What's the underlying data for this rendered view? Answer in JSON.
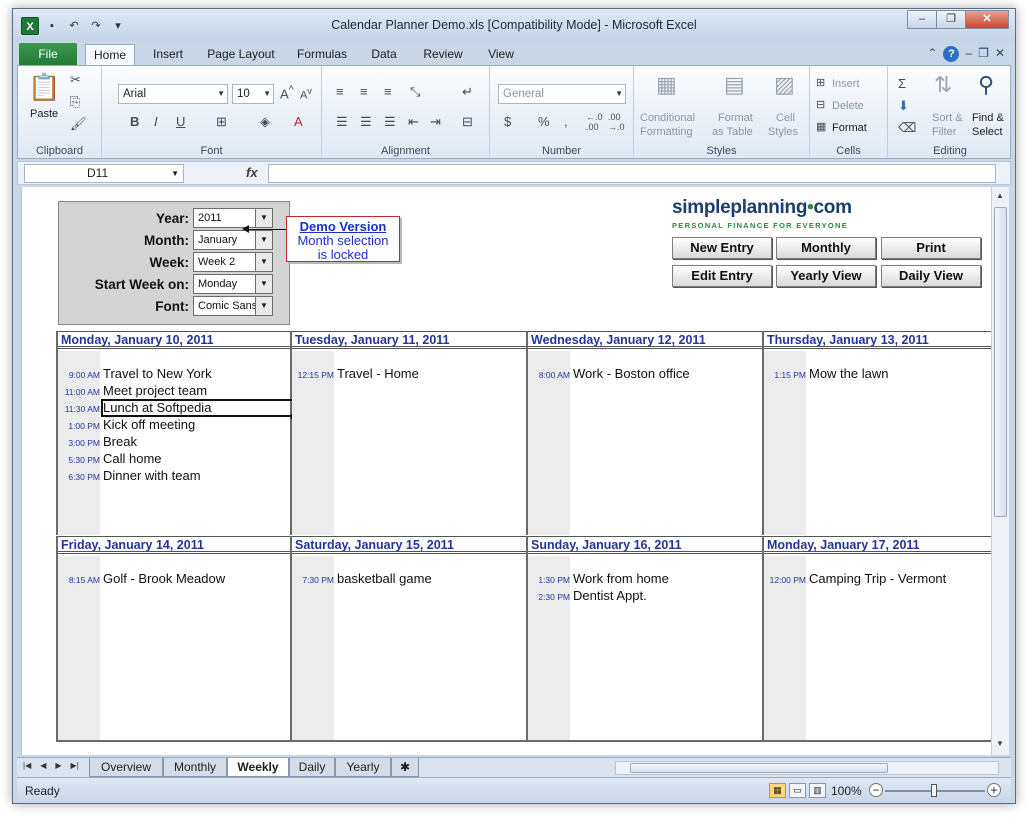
{
  "window": {
    "title": "Calendar Planner Demo.xls  [Compatibility Mode]  -  Microsoft Excel",
    "minimize": "–",
    "restore": "❐",
    "close": "✕"
  },
  "ribbon_tabs": [
    "File",
    "Home",
    "Insert",
    "Page Layout",
    "Formulas",
    "Data",
    "Review",
    "View"
  ],
  "ribbon": {
    "clipboard": {
      "label": "Clipboard",
      "paste": "Paste"
    },
    "font": {
      "label": "Font",
      "name": "Arial",
      "size": "10"
    },
    "alignment": {
      "label": "Alignment"
    },
    "number": {
      "label": "Number",
      "format": "General",
      "dollar": "$",
      "percent": "%",
      "comma": ","
    },
    "styles": {
      "label": "Styles",
      "conditional": "Conditional",
      "formatting": "Formatting",
      "format": "Format",
      "as_table": "as Table",
      "cell": "Cell",
      "cell_styles": "Styles"
    },
    "cells": {
      "label": "Cells",
      "insert": "Insert",
      "delete": "Delete",
      "format": "Format"
    },
    "editing": {
      "label": "Editing",
      "sort": "Sort &",
      "filter": "Filter",
      "find": "Find &",
      "select": "Select"
    }
  },
  "formula_bar": {
    "name_box": "D11",
    "fx": "fx",
    "value": ""
  },
  "controls": {
    "year": {
      "label": "Year:",
      "value": "2011"
    },
    "month": {
      "label": "Month:",
      "value": "January"
    },
    "week": {
      "label": "Week:",
      "value": "Week 2"
    },
    "start_week": {
      "label": "Start Week on:",
      "value": "Monday"
    },
    "font": {
      "label": "Font:",
      "value": "Comic Sans"
    }
  },
  "demo_note": {
    "title": "Demo Version",
    "line1": "Month selection",
    "line2": "is locked"
  },
  "logo": {
    "main": "simpleplanning",
    "dot": "•",
    "suffix": "com",
    "tagline": "PERSONAL FINANCE FOR EVERYONE"
  },
  "buttons": {
    "new_entry": "New Entry",
    "monthly": "Monthly",
    "print": "Print",
    "edit_entry": "Edit Entry",
    "yearly_view": "Yearly View",
    "daily_view": "Daily View"
  },
  "days": [
    {
      "header": "Monday, January 10, 2011",
      "entries": [
        {
          "time": "9:00 AM",
          "text": "Travel to New York"
        },
        {
          "time": "11:00 AM",
          "text": "Meet project team"
        },
        {
          "time": "11:30 AM",
          "text": "Lunch at Softpedia"
        },
        {
          "time": "1:00 PM",
          "text": "Kick off meeting"
        },
        {
          "time": "3:00 PM",
          "text": "Break"
        },
        {
          "time": "5:30 PM",
          "text": "Call home"
        },
        {
          "time": "6:30 PM",
          "text": "Dinner with team"
        }
      ]
    },
    {
      "header": "Tuesday, January 11, 2011",
      "entries": [
        {
          "time": "12:15 PM",
          "text": "Travel - Home"
        }
      ]
    },
    {
      "header": "Wednesday, January 12, 2011",
      "entries": [
        {
          "time": "8:00 AM",
          "text": "Work - Boston office"
        }
      ]
    },
    {
      "header": "Thursday, January 13, 2011",
      "entries": [
        {
          "time": "1:15 PM",
          "text": "Mow the lawn"
        }
      ]
    },
    {
      "header": "Friday, January 14, 2011",
      "entries": [
        {
          "time": "8:15 AM",
          "text": "Golf - Brook Meadow"
        }
      ]
    },
    {
      "header": "Saturday, January 15, 2011",
      "entries": [
        {
          "time": "7:30 PM",
          "text": "basketball game"
        }
      ]
    },
    {
      "header": "Sunday, January 16, 2011",
      "entries": [
        {
          "time": "1:30 PM",
          "text": "Work from home"
        },
        {
          "time": "2:30 PM",
          "text": "Dentist Appt."
        }
      ]
    },
    {
      "header": "Monday, January 17, 2011",
      "entries": [
        {
          "time": "12:00 PM",
          "text": "Camping Trip - Vermont"
        }
      ]
    }
  ],
  "sheet_tabs": [
    "Overview",
    "Monthly",
    "Weekly",
    "Daily",
    "Yearly"
  ],
  "active_sheet": "Weekly",
  "status": {
    "text": "Ready",
    "zoom": "100%"
  }
}
